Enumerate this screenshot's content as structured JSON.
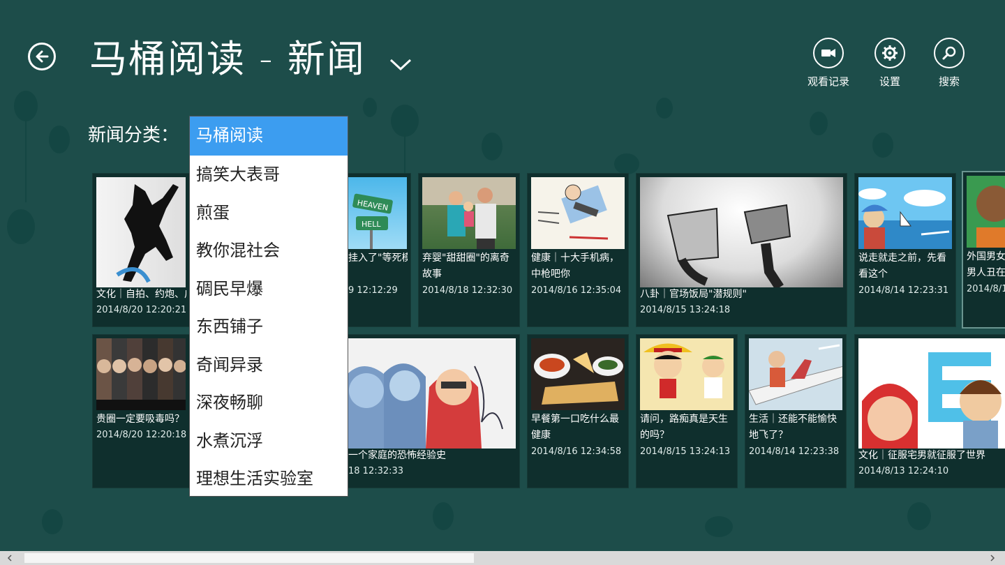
{
  "header": {
    "title": "马桶阅读 - 新闻",
    "actions": [
      {
        "label": "观看记录",
        "icon": "video-camera-icon"
      },
      {
        "label": "设置",
        "icon": "gear-icon"
      },
      {
        "label": "搜索",
        "icon": "search-icon"
      }
    ]
  },
  "category": {
    "label": "新闻分类：",
    "selected": "马桶阅读",
    "options": [
      "马桶阅读",
      "搞笑大表哥",
      "煎蛋",
      "教你混社会",
      "碉民早爆",
      "东西铺子",
      "奇闻异录",
      "深夜畅聊",
      "水煮沉浮",
      "理想生活实验室"
    ]
  },
  "tiles": [
    {
      "caption": "文化｜自拍、约炮、广",
      "date": "2014/8/20 12:20:21"
    },
    {
      "caption": "挂入了\"等死模",
      "date": "9 12:12:29"
    },
    {
      "caption": "弃婴\"甜甜圈\"的离奇故事",
      "date": "2014/8/18 12:32:30"
    },
    {
      "caption": "健康｜十大手机病，中枪吧你",
      "date": "2014/8/16 12:35:04"
    },
    {
      "caption": "八卦｜官场饭局\"潜规则\"",
      "date": "2014/8/15 13:24:18"
    },
    {
      "caption": "说走就走之前，先看看这个",
      "date": "2014/8/14 12:23:31"
    },
    {
      "caption": "外国男女男人丑在",
      "date": "2014/8/1"
    },
    {
      "caption": "贵圈一定要吸毒吗？",
      "date": "2014/8/20 12:20:18"
    },
    {
      "caption": "一个家庭的恐怖经验史",
      "date": "18 12:32:33"
    },
    {
      "caption": "早餐第一口吃什么最健康",
      "date": "2014/8/16 12:34:58"
    },
    {
      "caption": "请问，路痴真是天生的吗？",
      "date": "2014/8/15 13:24:13"
    },
    {
      "caption": "生活｜还能不能愉快地飞了？",
      "date": "2014/8/14 12:23:38"
    },
    {
      "caption": "文化｜征服宅男就征服了世界",
      "date": "2014/8/13 12:24:10"
    }
  ],
  "image_texts": {
    "heaven": "HEAVEN",
    "hell": "HELL"
  },
  "colors": {
    "background": "#1d4d4a",
    "tile": "#0f2f2d",
    "selected": "#3c9df0"
  }
}
